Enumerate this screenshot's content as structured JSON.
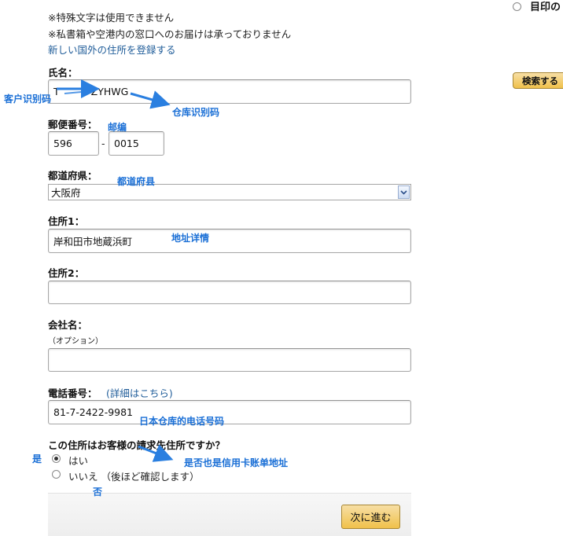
{
  "notices": {
    "special_chars": "※特殊文字は使用できません",
    "po_box": "※私書箱や空港内の窓口へのお届けは承っておりません",
    "register_foreign": "新しい国外の住所を登録する"
  },
  "right_panel": {
    "radio_label": "目印の",
    "search_button": "検索する"
  },
  "form": {
    "name": {
      "label": "氏名：",
      "value": "T",
      "value_suffix": "ZYHWG"
    },
    "postal": {
      "label": "郵便番号：",
      "part1": "596",
      "separator": "-",
      "part2": "0015"
    },
    "prefecture": {
      "label": "都道府県：",
      "value": "大阪府"
    },
    "address1": {
      "label": "住所1：",
      "value": "岸和田市地蔵浜町"
    },
    "address2": {
      "label": "住所2：",
      "value": ""
    },
    "company": {
      "label": "会社名：",
      "sub": "（オプション）",
      "value": ""
    },
    "phone": {
      "label": "電話番号：",
      "details_link": "(詳細はこちら)",
      "value": "81-7-2422-9981"
    },
    "billing_question": "この住所はお客様の請求先住所ですか？",
    "billing_yes": "はい",
    "billing_no": "いいえ （後ほど確認します）",
    "next_button": "次に進む"
  },
  "annotations": {
    "customer_code": "客户识别码",
    "warehouse_code": "仓库识别码",
    "zip": "邮编",
    "prefecture": "都道府县",
    "address_detail": "地址详情",
    "warehouse_phone": "日本仓库的电话号码",
    "billing_note": "是否也是信用卡账单地址",
    "yes": "是",
    "no": "否"
  },
  "colors": {
    "annotation": "#1a6fd6",
    "link": "#1f5c99",
    "button": "#f0c14b"
  }
}
